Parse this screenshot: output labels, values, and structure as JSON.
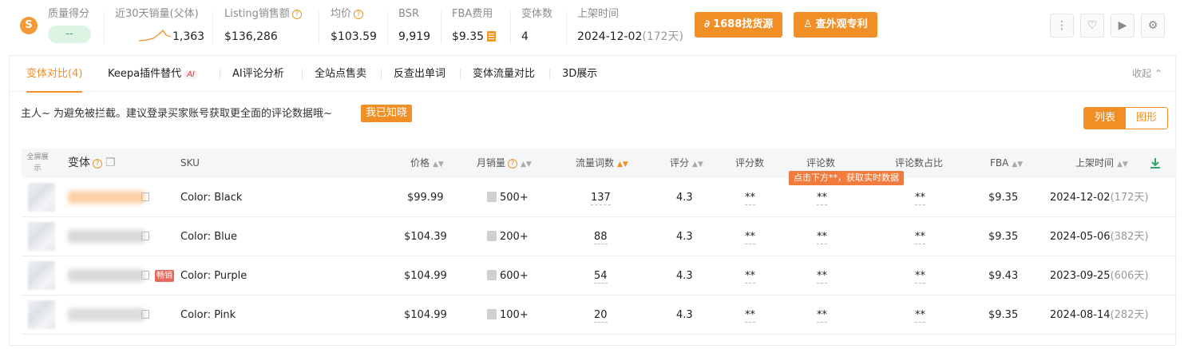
{
  "header": {
    "logo_letter": "S",
    "quality": {
      "label": "质量得分",
      "value": "--"
    },
    "sales30": {
      "label": "近30天销量(父体)",
      "value": "1,363"
    },
    "listing_sales": {
      "label": "Listing销售额",
      "value": "$136,286"
    },
    "avg_price": {
      "label": "均价",
      "value": "$103.59"
    },
    "bsr": {
      "label": "BSR",
      "value": "9,919"
    },
    "fba_fee": {
      "label": "FBA费用",
      "value": "$9.35"
    },
    "variants": {
      "label": "变体数",
      "value": "4"
    },
    "listed": {
      "label": "上架时间",
      "date": "2024-12-02",
      "days": "(172天)"
    },
    "btn_1688": {
      "icon": "1688-icon",
      "label": "1688找货源"
    },
    "btn_patent": {
      "icon": "design-patent-icon",
      "label": "查外观专利"
    },
    "icon_buttons": [
      "more-icon",
      "heart-icon",
      "video-icon",
      "gear-icon"
    ]
  },
  "tabs": [
    {
      "label": "变体对比(4)",
      "active": true
    },
    {
      "label": "Keepa插件替代",
      "badge": "AI"
    },
    {
      "label": "AI评论分析"
    },
    {
      "label": "全站点售卖"
    },
    {
      "label": "反查出单词"
    },
    {
      "label": "变体流量对比"
    },
    {
      "label": "3D展示"
    }
  ],
  "collapse_label": "收起",
  "notice": {
    "text": "主人~ 为避免被拦截。建议登录买家账号获取更全面的评论数据哦~",
    "button": "我已知晓"
  },
  "view_toggle": {
    "list": "列表",
    "chart": "图形"
  },
  "table": {
    "fullscreen_label": "全屏展示",
    "columns": {
      "variant": "变体",
      "sku": "SKU",
      "price": "价格",
      "monthly_sales": "月销量",
      "traffic_words": "流量词数",
      "rating": "评分",
      "rating_count": "评分数",
      "review_count": "评论数",
      "review_ratio": "评论数占比",
      "fba": "FBA",
      "listed": "上架时间"
    },
    "review_tip": "点击下方**，获取实时数据",
    "rows": [
      {
        "sku": "Color: Black",
        "price": "$99.99",
        "sales": "500+",
        "traffic": "137",
        "rating": "4.3",
        "rating_count": "**",
        "review_count": "**",
        "review_ratio": "**",
        "fba": "$9.35",
        "date": "2024-12-02",
        "days": "(172天)",
        "hot": ""
      },
      {
        "sku": "Color: Blue",
        "price": "$104.39",
        "sales": "200+",
        "traffic": "88",
        "rating": "4.3",
        "rating_count": "**",
        "review_count": "**",
        "review_ratio": "**",
        "fba": "$9.35",
        "date": "2024-05-06",
        "days": "(382天)",
        "hot": ""
      },
      {
        "sku": "Color: Purple",
        "price": "$104.99",
        "sales": "600+",
        "traffic": "54",
        "rating": "4.3",
        "rating_count": "**",
        "review_count": "**",
        "review_ratio": "**",
        "fba": "$9.43",
        "date": "2023-09-25",
        "days": "(606天)",
        "hot": "畅销"
      },
      {
        "sku": "Color: Pink",
        "price": "$104.99",
        "sales": "100+",
        "traffic": "20",
        "rating": "4.3",
        "rating_count": "**",
        "review_count": "**",
        "review_ratio": "**",
        "fba": "$9.35",
        "date": "2024-08-14",
        "days": "(282天)",
        "hot": ""
      }
    ]
  },
  "colors": {
    "accent": "#f08f26",
    "quality_bg": "#ddf3e4",
    "quality_text": "#3aa55c",
    "hot_badge": "#e8675a",
    "tip_bg": "#f07b3c"
  }
}
